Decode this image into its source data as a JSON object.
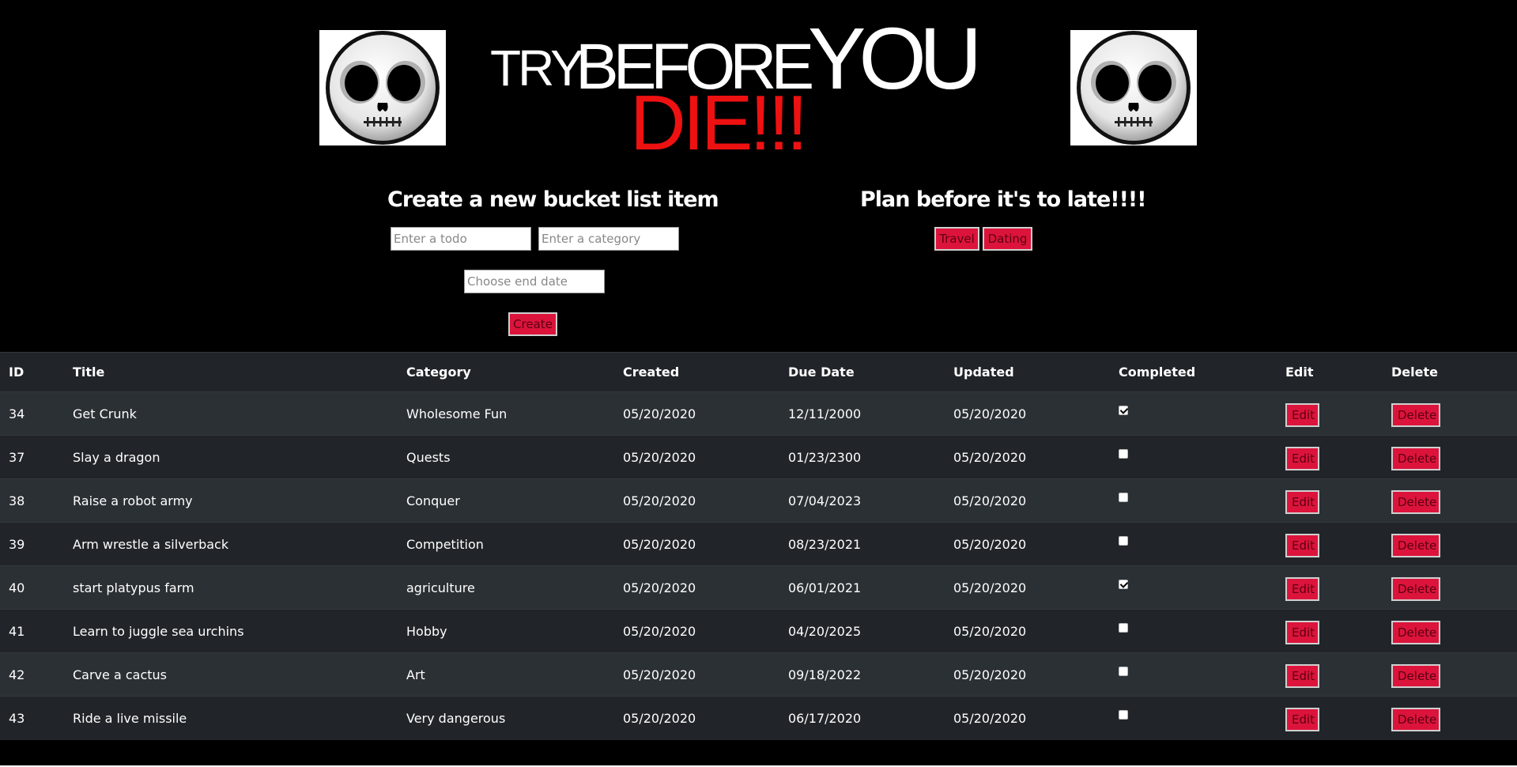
{
  "header": {
    "title_try": "TRY",
    "title_before": "BEFORE",
    "title_you": "YOU",
    "title_die": "DIE!!!",
    "logo_icon": "skull-icon"
  },
  "create_form": {
    "heading": "Create a new bucket list item",
    "todo_placeholder": "Enter a todo",
    "category_placeholder": "Enter a category",
    "date_placeholder": "Choose end date",
    "create_label": "Create"
  },
  "plan": {
    "heading": "Plan before it's to late!!!!",
    "buttons": [
      "Travel",
      "Dating"
    ]
  },
  "table": {
    "headers": [
      "ID",
      "Title",
      "Category",
      "Created",
      "Due Date",
      "Updated",
      "Completed",
      "Edit",
      "Delete"
    ],
    "edit_label": "Edit",
    "delete_label": "Delete",
    "rows": [
      {
        "id": "34",
        "title": "Get Crunk",
        "category": "Wholesome Fun",
        "created": "05/20/2020",
        "due": "12/11/2000",
        "updated": "05/20/2020",
        "completed": true
      },
      {
        "id": "37",
        "title": "Slay a dragon",
        "category": "Quests",
        "created": "05/20/2020",
        "due": "01/23/2300",
        "updated": "05/20/2020",
        "completed": false
      },
      {
        "id": "38",
        "title": "Raise a robot army",
        "category": "Conquer",
        "created": "05/20/2020",
        "due": "07/04/2023",
        "updated": "05/20/2020",
        "completed": false
      },
      {
        "id": "39",
        "title": "Arm wrestle a silverback",
        "category": "Competition",
        "created": "05/20/2020",
        "due": "08/23/2021",
        "updated": "05/20/2020",
        "completed": false
      },
      {
        "id": "40",
        "title": "start platypus farm",
        "category": "agriculture",
        "created": "05/20/2020",
        "due": "06/01/2021",
        "updated": "05/20/2020",
        "completed": true
      },
      {
        "id": "41",
        "title": "Learn to juggle sea urchins",
        "category": "Hobby",
        "created": "05/20/2020",
        "due": "04/20/2025",
        "updated": "05/20/2020",
        "completed": false
      },
      {
        "id": "42",
        "title": "Carve a cactus",
        "category": "Art",
        "created": "05/20/2020",
        "due": "09/18/2022",
        "updated": "05/20/2020",
        "completed": false
      },
      {
        "id": "43",
        "title": "Ride a live missile",
        "category": "Very dangerous",
        "created": "05/20/2020",
        "due": "06/17/2020",
        "updated": "05/20/2020",
        "completed": false
      }
    ]
  },
  "colors": {
    "background": "#000000",
    "accent_red": "#dc143c",
    "die_red": "#ee1111",
    "table_dark": "#212529",
    "table_stripe": "#2b3035"
  }
}
